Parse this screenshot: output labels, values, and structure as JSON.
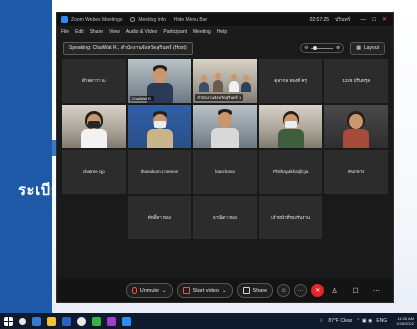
{
  "slide": {
    "thai_text": "ระเบีย"
  },
  "window": {
    "app_title": "Zoom Webex Meetings",
    "meeting_info": "Meeting Info",
    "host_menu": "Hide Menu Bar",
    "timer": "02:57:25",
    "user": "ปรินทร์",
    "min_label": "—",
    "max_label": "□",
    "close_label": "✕"
  },
  "menubar": [
    "File",
    "Edit",
    "Share",
    "View",
    "Audio & Video",
    "Participant",
    "Meeting",
    "Help"
  ],
  "topbar": {
    "speaking": "Speaking: ChaiWat R., สำนักงานจังหวัดสุรินทร์ (Host)",
    "layout_label": "Layout"
  },
  "tiles": [
    {
      "kind": "name",
      "name": "ตำลดาวา tu"
    },
    {
      "kind": "video",
      "scene": "host",
      "badge": "ChaiWat R."
    },
    {
      "kind": "video",
      "scene": "room",
      "badge": "สำนักงานจังหวัดสุรินทร์ 1"
    },
    {
      "kind": "name",
      "name": "ดุลากล ทองดี ครุ"
    },
    {
      "kind": "name",
      "name": "1229 ปรินทรุล"
    },
    {
      "kind": "video",
      "scene": "mask-woman",
      "badge": ""
    },
    {
      "kind": "video",
      "scene": "mask-man",
      "badge": ""
    },
    {
      "kind": "video",
      "scene": "man-office",
      "badge": ""
    },
    {
      "kind": "video",
      "scene": "woman-mask2",
      "badge": ""
    },
    {
      "kind": "video",
      "scene": "woman-glasses",
      "badge": ""
    },
    {
      "kind": "name",
      "name": "chatree cjp"
    },
    {
      "kind": "name",
      "name": "thanakorn.t.meeon"
    },
    {
      "kind": "name",
      "name": "kanchana"
    },
    {
      "kind": "name",
      "name": "Phithayakha@cja"
    },
    {
      "kind": "name",
      "name": "คนกลาง"
    },
    {
      "kind": "empty",
      "name": ""
    },
    {
      "kind": "name",
      "name": "ศักดิ์ดา ทอง"
    },
    {
      "kind": "name",
      "name": "ธาณิดา ทอง"
    },
    {
      "kind": "name",
      "name": "เจ้าหน้าที่รองรับงาน"
    },
    {
      "kind": "empty",
      "name": ""
    }
  ],
  "toolbar": {
    "unmute": "Unmute",
    "start_video": "Start video",
    "share": "Share",
    "end_label": "✕",
    "more_label": "···"
  },
  "taskbar": {
    "weather": "87°F Clear",
    "lang": "ENG",
    "time": "11:26 AM",
    "date": "1/26/2022"
  },
  "colors": {
    "accent": "#2d8cff",
    "end_red": "#e02828",
    "active_outline": "#2fbf5b"
  }
}
